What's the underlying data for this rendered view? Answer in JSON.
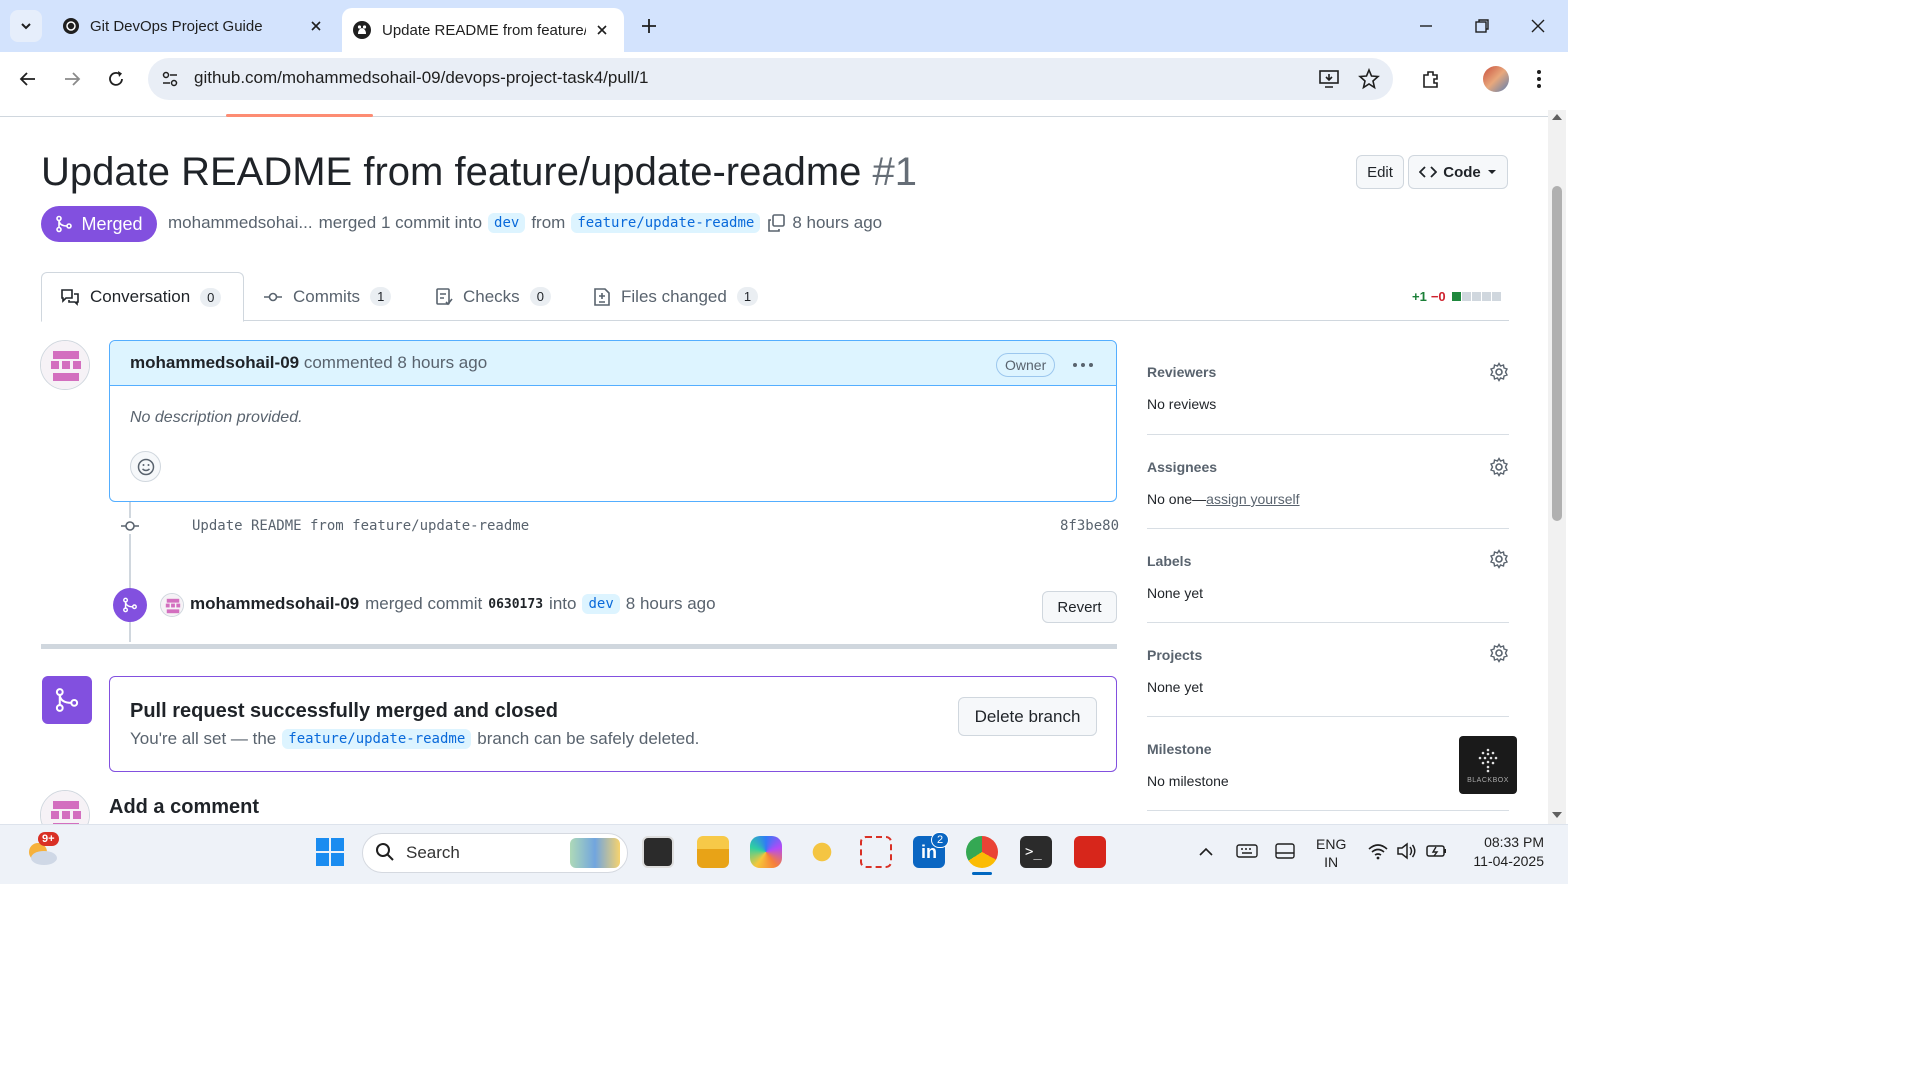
{
  "browser": {
    "tabs": [
      {
        "title": "Git DevOps Project Guide",
        "active": false
      },
      {
        "title": "Update README from feature/u",
        "active": true
      }
    ],
    "url": "github.com/mohammedsohail-09/devops-project-task4/pull/1"
  },
  "pr": {
    "title": "Update README from feature/update-readme",
    "number": "#1",
    "status": "Merged",
    "author_short": "mohammedsohai...",
    "merged_text": "merged 1 commit into",
    "base_branch": "dev",
    "from_text": "from",
    "head_branch": "feature/update-readme",
    "time_ago": "8 hours ago",
    "edit_label": "Edit",
    "code_label": "Code"
  },
  "tabs": [
    {
      "label": "Conversation",
      "count": "0"
    },
    {
      "label": "Commits",
      "count": "1"
    },
    {
      "label": "Checks",
      "count": "0"
    },
    {
      "label": "Files changed",
      "count": "1"
    }
  ],
  "diffstat": {
    "additions": "+1",
    "deletions": "−0"
  },
  "comment": {
    "author": "mohammedsohail-09",
    "action": "commented 8 hours ago",
    "role": "Owner",
    "body": "No description provided."
  },
  "commit": {
    "message": "Update README from feature/update-readme",
    "sha": "8f3be80"
  },
  "merge_event": {
    "author": "mohammedsohail-09",
    "action": "merged commit",
    "sha": "0630173",
    "into": "into",
    "branch": "dev",
    "time": "8 hours ago",
    "revert_label": "Revert"
  },
  "merged_box": {
    "title": "Pull request successfully merged and closed",
    "prefix": "You're all set — the",
    "branch": "feature/update-readme",
    "suffix": "branch can be safely deleted.",
    "button": "Delete branch"
  },
  "add_comment": "Add a comment",
  "sidebar": {
    "reviewers": {
      "title": "Reviewers",
      "value": "No reviews"
    },
    "assignees": {
      "title": "Assignees",
      "value": "No one—",
      "link": "assign yourself"
    },
    "labels": {
      "title": "Labels",
      "value": "None yet"
    },
    "projects": {
      "title": "Projects",
      "value": "None yet"
    },
    "milestone": {
      "title": "Milestone",
      "value": "No milestone"
    }
  },
  "blackbox_label": "BLACKBOX",
  "taskbar": {
    "search_placeholder": "Search",
    "weather_badge": "9+",
    "linkedin_badge": "2",
    "lang": "ENG",
    "region": "IN",
    "time": "08:33 PM",
    "date": "11-04-2025"
  },
  "colors": {
    "accent": "#8250df",
    "link": "#0969da",
    "tab_underline": "#fd8c73"
  }
}
